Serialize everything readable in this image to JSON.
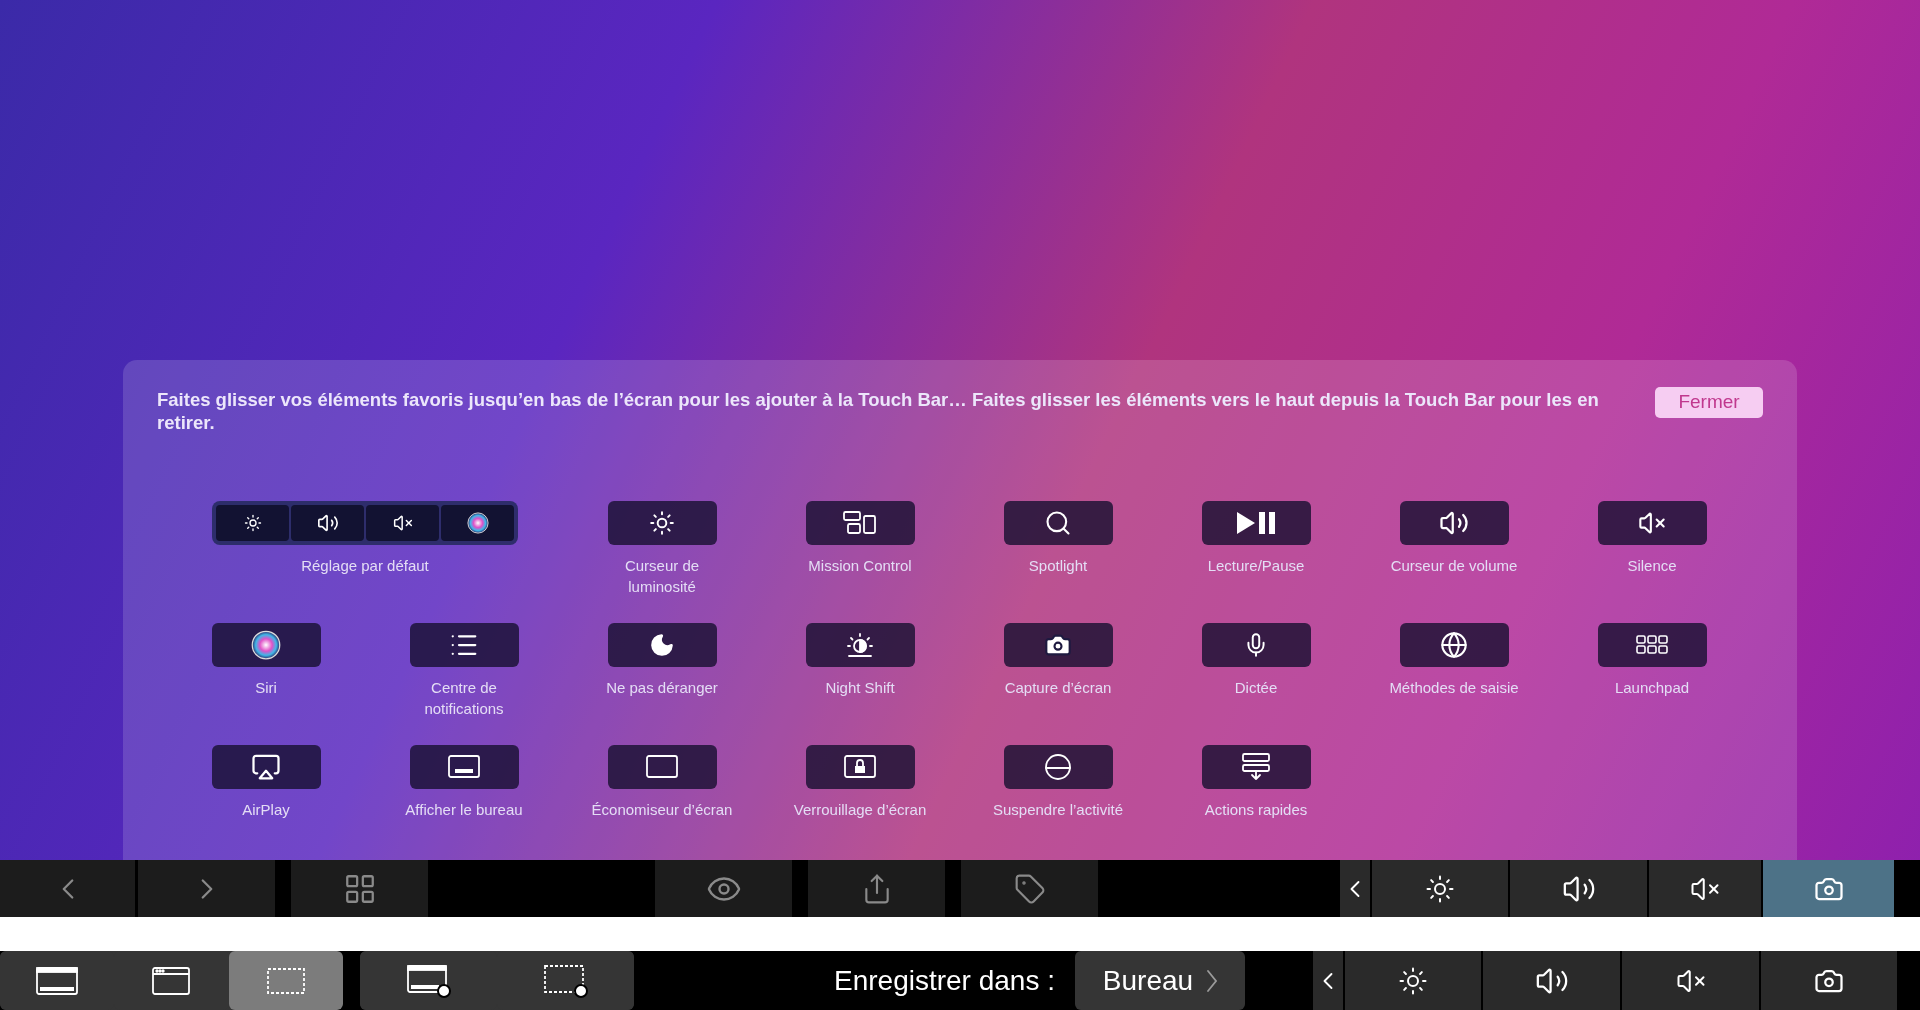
{
  "panel": {
    "instructions": "Faites glisser vos éléments favoris jusqu’en bas de l’écran pour les ajouter à la Touch Bar… Faites glisser les éléments vers le haut depuis la Touch Bar pour les en retirer.",
    "close_button": "Fermer",
    "items": [
      {
        "kind": "group",
        "label": "Réglage par défaut"
      },
      {
        "kind": "button",
        "label": "Curseur de\nluminosité"
      },
      {
        "kind": "button",
        "label": "Mission Control"
      },
      {
        "kind": "button",
        "label": "Spotlight"
      },
      {
        "kind": "button",
        "label": "Lecture/Pause"
      },
      {
        "kind": "button",
        "label": "Curseur de volume"
      },
      {
        "kind": "button",
        "label": "Silence"
      },
      {
        "kind": "button",
        "label": "Siri"
      },
      {
        "kind": "button",
        "label": "Centre de\nnotifications"
      },
      {
        "kind": "button",
        "label": "Ne pas déranger"
      },
      {
        "kind": "button",
        "label": "Night Shift"
      },
      {
        "kind": "button",
        "label": "Capture d’écran"
      },
      {
        "kind": "button",
        "label": "Dictée"
      },
      {
        "kind": "button",
        "label": "Méthodes de saisie"
      },
      {
        "kind": "button",
        "label": "Launchpad"
      },
      {
        "kind": "button",
        "label": "AirPlay"
      },
      {
        "kind": "button",
        "label": "Afficher le bureau"
      },
      {
        "kind": "button",
        "label": "Économiseur d’écran"
      },
      {
        "kind": "button",
        "label": "Verrouillage d’écran"
      },
      {
        "kind": "button",
        "label": "Suspendre l’activité"
      },
      {
        "kind": "button",
        "label": "Actions rapides"
      }
    ]
  },
  "touch_bar": {
    "control_strip": [
      {
        "selected": false
      },
      {
        "selected": false
      },
      {
        "selected": false
      },
      {
        "selected": true
      }
    ]
  },
  "capture_bar": {
    "modes": [
      {
        "selected": false
      },
      {
        "selected": false
      },
      {
        "selected": true
      },
      {
        "selected": false
      },
      {
        "selected": false
      }
    ],
    "save_label": "Enregistrer dans :",
    "save_location": "Bureau"
  }
}
